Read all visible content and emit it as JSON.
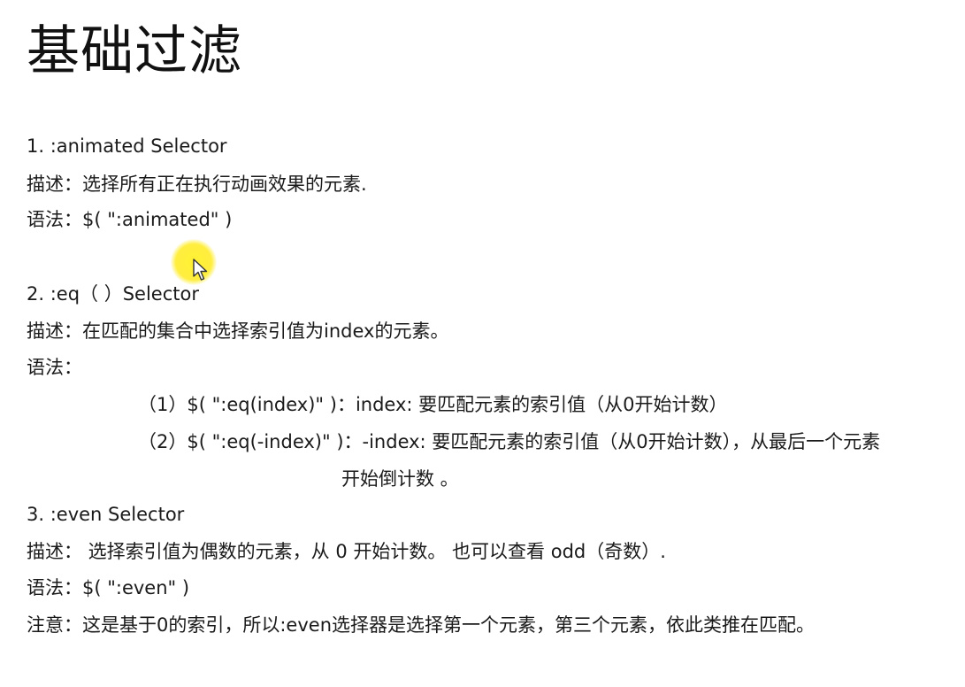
{
  "title": "基础过滤",
  "sections": [
    {
      "heading": "1. :animated Selector",
      "desc": "描述：选择所有正在执行动画效果的元素.",
      "syntax": "语法：$( \":animated\" )"
    },
    {
      "heading": "2. :eq（ ）Selector",
      "desc": "描述：在匹配的集合中选择索引值为index的元素。",
      "syntax": "语法：",
      "items": [
        "（1）$( \":eq(index)\" )：index: 要匹配元素的索引值（从0开始计数）",
        "（2）$( \":eq(-index)\" )：-index: 要匹配元素的索引值（从0开始计数），从最后一个元素",
        "开始倒计数 。"
      ]
    },
    {
      "heading": "3. :even Selector",
      "desc": "描述： 选择索引值为偶数的元素，从 0 开始计数。 也可以查看 odd（奇数）.",
      "syntax": "语法：$( \":even\" )",
      "note": "注意：这是基于0的索引，所以:even选择器是选择第一个元素，第三个元素，依此类推在匹配。"
    }
  ],
  "cursor": {
    "icon": "mouse-pointer-icon",
    "highlight_color": "#ffeb1e"
  }
}
